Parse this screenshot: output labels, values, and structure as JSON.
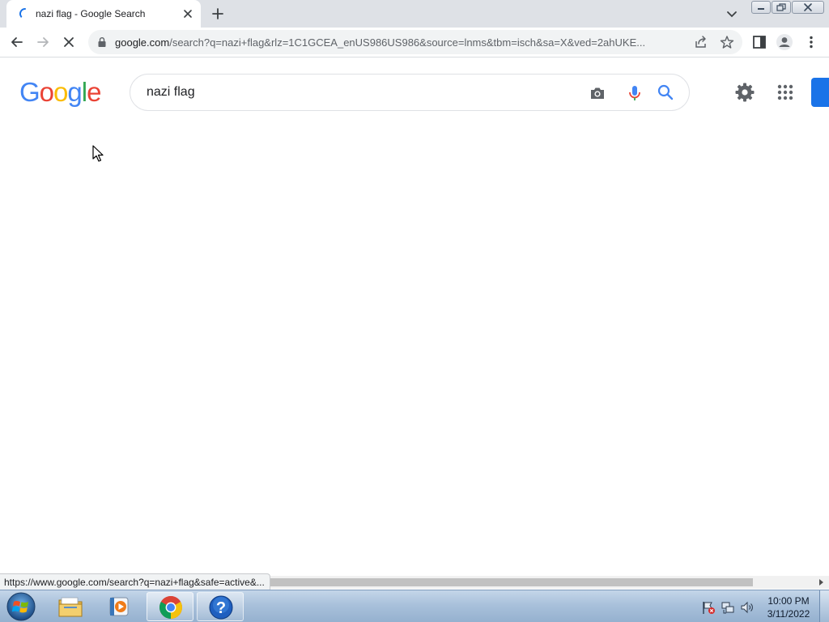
{
  "browser": {
    "tab": {
      "title": "nazi flag - Google Search"
    },
    "address_bar": {
      "host": "google.com",
      "path": "/search?q=nazi+flag&rlz=1C1GCEA_enUS986US986&source=lnms&tbm=isch&sa=X&ved=2ahUKE..."
    },
    "status_url": "https://www.google.com/search?q=nazi+flag&safe=active&..."
  },
  "google": {
    "logo_letters": [
      "G",
      "o",
      "o",
      "g",
      "l",
      "e"
    ],
    "search_query": "nazi flag"
  },
  "taskbar": {
    "clock_time": "10:00 PM",
    "clock_date": "3/11/2022"
  },
  "colors": {
    "google_blue": "#4285f4",
    "google_red": "#ea4335",
    "google_yellow": "#fbbc05",
    "google_green": "#34a853",
    "signin_blue": "#1a73e8"
  }
}
